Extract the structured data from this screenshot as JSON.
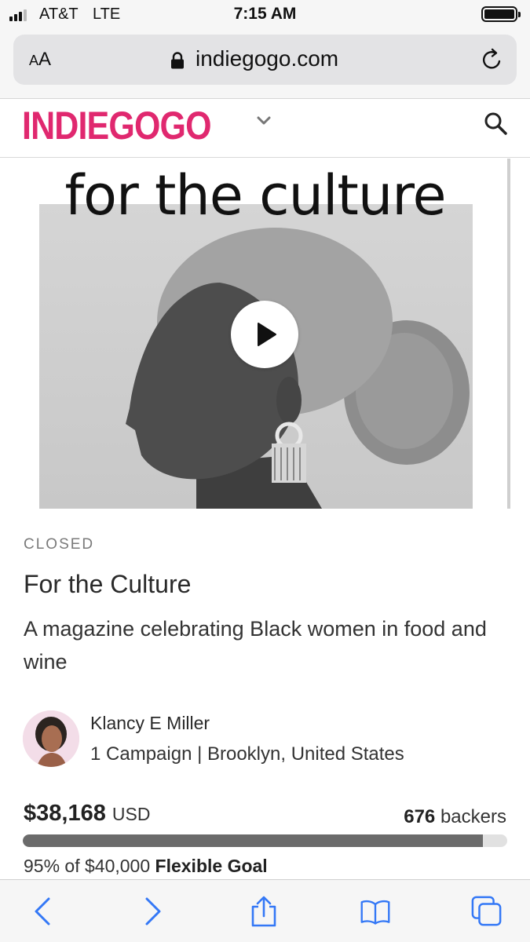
{
  "status_bar": {
    "carrier": "AT&T",
    "network": "LTE",
    "time": "7:15 AM"
  },
  "browser": {
    "text_size_label_small": "A",
    "text_size_label_large": "A",
    "url": "indiegogo.com"
  },
  "site": {
    "logo": "INDIEGOGO"
  },
  "hero": {
    "image_title": "for the culture"
  },
  "campaign": {
    "status": "CLOSED",
    "title": "For the Culture",
    "tagline": "A magazine celebrating Black women in food and wine",
    "creator_name": "Klancy E Miller",
    "creator_meta": "1 Campaign | Brooklyn, United States",
    "amount_raised": "$38,168",
    "currency": "USD",
    "backers_count": "676",
    "backers_label": "backers",
    "percent_funded": 95,
    "goal_text": "95% of $40,000",
    "goal_type": "Flexible Goal"
  },
  "colors": {
    "brand": "#e0286f",
    "ios_blue": "#3478f6",
    "progress_fill": "#6b6b6b"
  },
  "icons": [
    "lock-icon",
    "reload-icon",
    "chevron-down-icon",
    "search-icon",
    "play-icon",
    "back-icon",
    "forward-icon",
    "share-icon",
    "bookmarks-icon",
    "tabs-icon"
  ]
}
